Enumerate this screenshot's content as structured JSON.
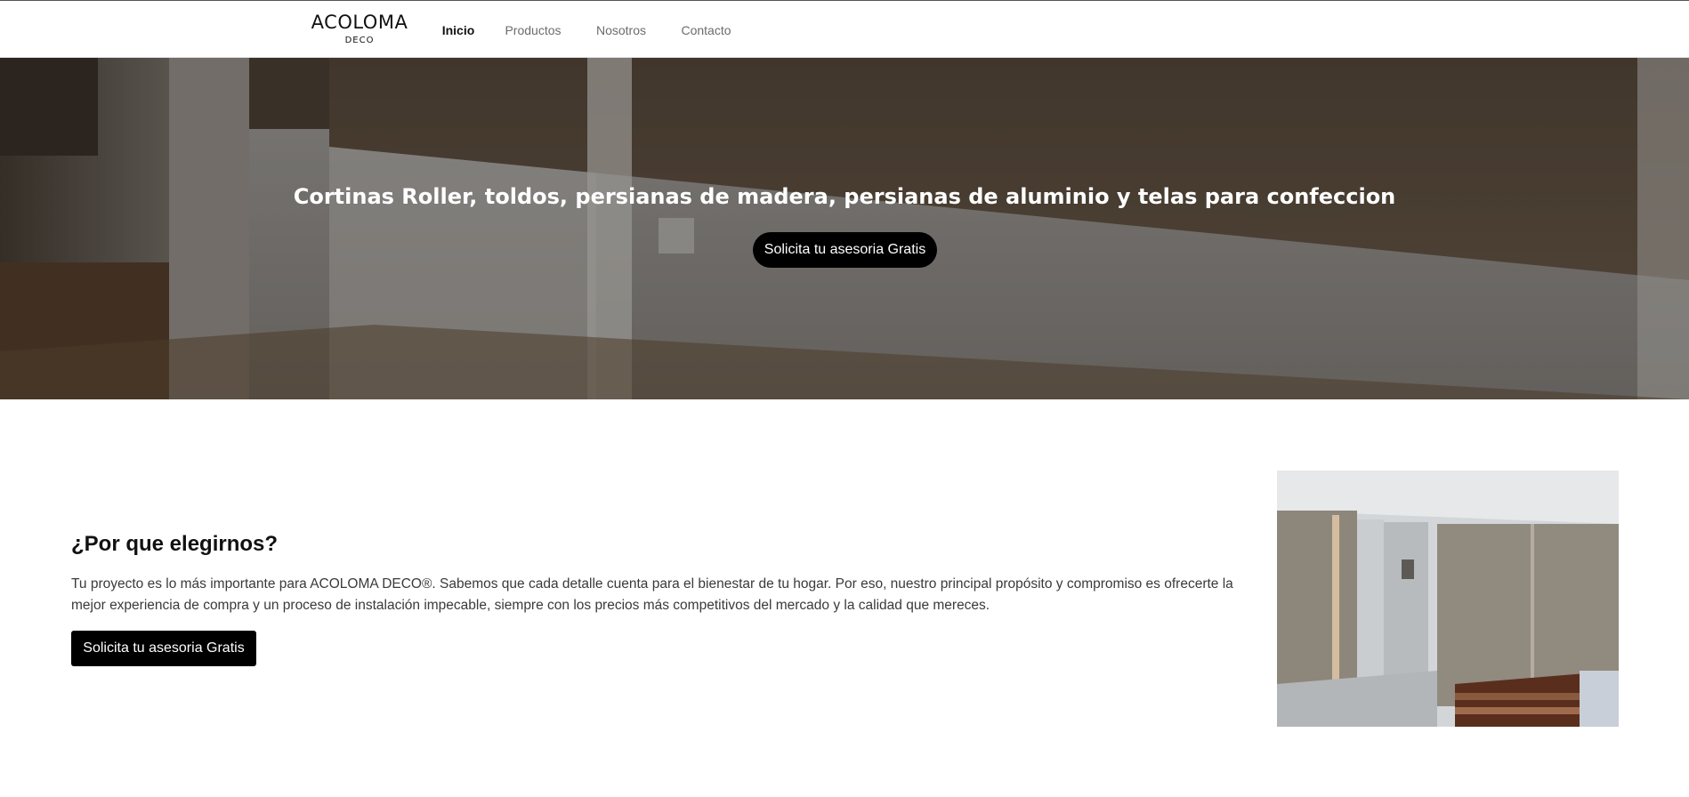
{
  "header": {
    "logo_main": "ACOLOMA",
    "logo_sub": "DECO",
    "nav": [
      "Inicio",
      "Productos",
      "Nosotros",
      "Contacto"
    ],
    "active_nav": "Inicio"
  },
  "hero": {
    "title": "Cortinas Roller, toldos, persianas de madera, persianas de aluminio y telas para confeccion",
    "cta": "Solicita tu asesoria Gratis"
  },
  "about": {
    "title": "¿Por que elegirnos?",
    "text": "Tu proyecto es lo más importante para ACOLOMA DECO®. Sabemos que cada detalle cuenta para el bienestar de tu hogar. Por eso, nuestro principal propósito y compromiso es ofrecerte la mejor experiencia de compra y un proceso de instalación impecable, siempre con los precios más competitivos del mercado y la calidad que mereces.",
    "cta": "Solicita tu asesoria Gratis"
  },
  "colors": {
    "accent": "#000000",
    "nav_inactive": "#6b6b6b",
    "text_body": "#3a3a3a"
  }
}
